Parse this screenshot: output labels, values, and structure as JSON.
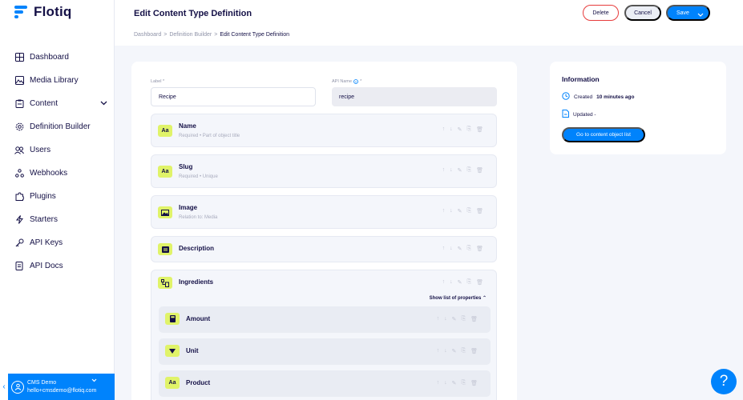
{
  "brand": {
    "name": "Flotiq",
    "color": "#0083fc"
  },
  "sidebar": {
    "items": [
      {
        "label": "Dashboard",
        "icon": "grid-icon"
      },
      {
        "label": "Media Library",
        "icon": "image-icon"
      },
      {
        "label": "Content",
        "icon": "clipboard-icon"
      },
      {
        "label": "Definition Builder",
        "icon": "gear-icon"
      },
      {
        "label": "Users",
        "icon": "users-icon"
      },
      {
        "label": "Webhooks",
        "icon": "webhook-icon"
      },
      {
        "label": "Plugins",
        "icon": "puzzle-icon"
      },
      {
        "label": "Starters",
        "icon": "bolt-icon"
      },
      {
        "label": "API Keys",
        "icon": "key-icon"
      },
      {
        "label": "API Docs",
        "icon": "doc-icon"
      }
    ],
    "user": {
      "name": "CMS Demo",
      "email": "hello+cmsdemo@flotiq.com"
    }
  },
  "header": {
    "title": "Edit Content Type Definition",
    "breadcrumb": [
      "Dashboard",
      "Definition Builder",
      "Edit Content Type Definition"
    ],
    "delete_label": "Delete",
    "cancel_label": "Cancel",
    "save_label": "Save"
  },
  "form": {
    "label_caption": "Label *",
    "label_value": "Recipe",
    "api_caption": "API Name",
    "api_required": "*",
    "api_value": "recipe",
    "fields": [
      {
        "name": "Name",
        "sub": "Required • Part of object title",
        "badge": "Aa"
      },
      {
        "name": "Slug",
        "sub": "Required • Unique",
        "badge": "Aa"
      },
      {
        "name": "Image",
        "sub": "Relation to: Media",
        "badge": "img"
      },
      {
        "name": "Description",
        "sub": "",
        "badge": "text"
      },
      {
        "name": "Ingredients",
        "sub": "",
        "badge": "list"
      }
    ],
    "show_props": "Show list of properties",
    "sub_fields": [
      {
        "name": "Amount",
        "badge": "num"
      },
      {
        "name": "Unit",
        "badge": "select"
      },
      {
        "name": "Product",
        "badge": "Aa"
      }
    ]
  },
  "info": {
    "title": "Information",
    "created_prefix": "Created",
    "created_value": "10 minutes ago",
    "updated_label": "Updated -",
    "button_label": "Go to content object list"
  },
  "help_label": "?"
}
